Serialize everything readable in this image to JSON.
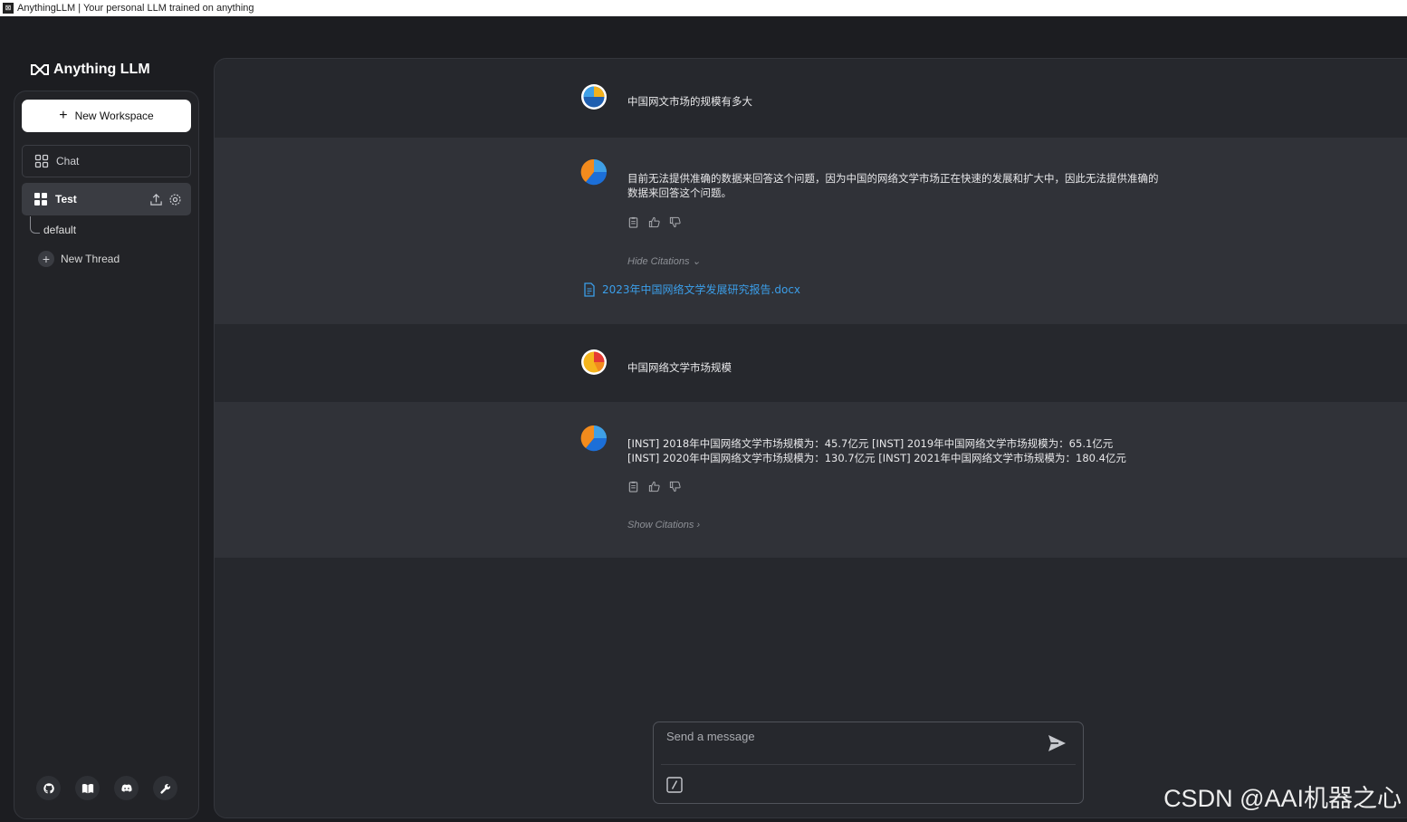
{
  "window": {
    "title": "AnythingLLM | Your personal LLM trained on anything"
  },
  "brand": {
    "name": "Anything LLM"
  },
  "sidebar": {
    "new_workspace_label": "New Workspace",
    "workspaces": [
      {
        "label": "Chat"
      },
      {
        "label": "Test"
      }
    ],
    "threads": [
      {
        "label": "default"
      }
    ],
    "new_thread_label": "New Thread",
    "footer_icons": [
      "github-icon",
      "docs-book-icon",
      "discord-icon",
      "wrench-settings-icon"
    ]
  },
  "chat": {
    "messages": [
      {
        "role": "user",
        "text": "中国网文市场的规模有多大"
      },
      {
        "role": "assistant",
        "text": "目前无法提供准确的数据来回答这个问题，因为中国的网络文学市场正在快速的发展和扩大中，因此无法提供准确的数据来回答这个问题。",
        "citations_toggle": "Hide Citations",
        "citations": [
          "2023年中国网络文学发展研究报告.docx"
        ]
      },
      {
        "role": "user",
        "text": "中国网络文学市场规模"
      },
      {
        "role": "assistant",
        "text": "[INST] 2018年中国网络文学市场规模为：45.7亿元 [INST] 2019年中国网络文学市场规模为：65.1亿元 [INST] 2020年中国网络文学市场规模为：130.7亿元 [INST] 2021年中国网络文学市场规模为：180.4亿元",
        "citations_toggle": "Show Citations"
      }
    ]
  },
  "composer": {
    "placeholder": "Send a message"
  },
  "watermark": "CSDN @AAI机器之心",
  "colors": {
    "background": "#1c1d21",
    "panel": "#26282d",
    "assistant_row": "#303238",
    "accent_link": "#3b9ee9"
  }
}
